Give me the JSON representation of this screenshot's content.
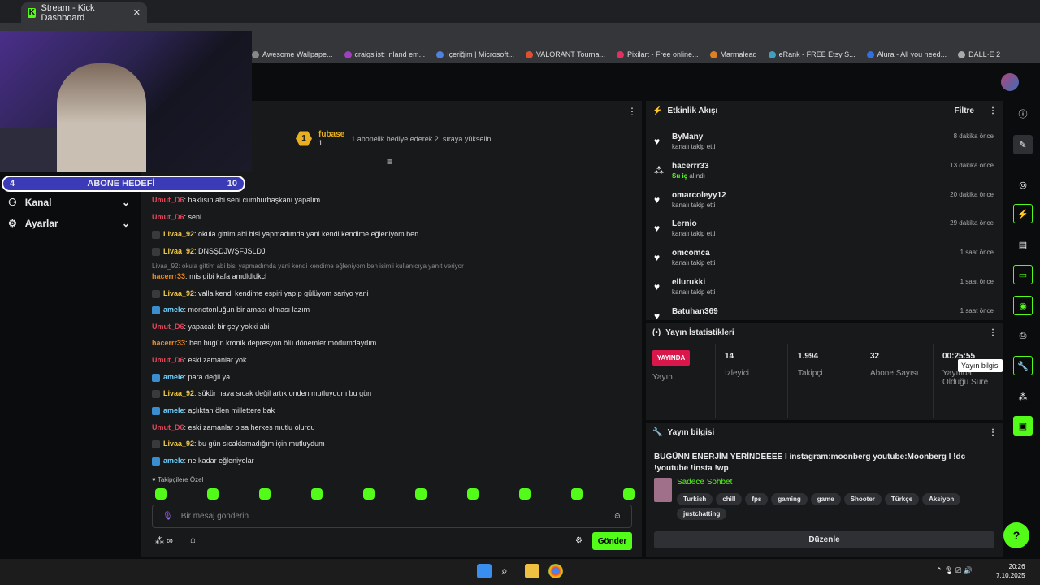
{
  "browser": {
    "tab_title": "Stream - Kick Dashboard",
    "bookmarks": [
      "Awesome Wallpape...",
      "craigslist: inland em...",
      "İçeriğim | Microsoft...",
      "VALORANT Tourna...",
      "Pixilart - Free online...",
      "Marmalead",
      "eRank - FREE Etsy S...",
      "Alura - All you need...",
      "DALL·E 2"
    ]
  },
  "overlay": {
    "sub_goal_current": "4",
    "sub_goal_label": "ABONE HEDEFİ",
    "sub_goal_target": "10"
  },
  "sidebar": {
    "items": [
      {
        "label": "Kanal",
        "icon": "people-icon"
      },
      {
        "label": "Ayarlar",
        "icon": "gear-icon"
      }
    ]
  },
  "chat": {
    "pinned": {
      "level": "1",
      "user": "fubase",
      "count": "1",
      "message": "1 abonelik hediye ederek 2. sıraya yükselin"
    },
    "messages": [
      {
        "user": "amele",
        "text": "",
        "color": "#6fd3ff"
      },
      {
        "user": "Umut_D6",
        "text": "haklısın abi seni cumhurbaşkanı yapalım",
        "color": "#e0465b"
      },
      {
        "user": "Umut_D6",
        "text": "seni",
        "color": "#e0465b"
      },
      {
        "user": "Livaa_92",
        "text": "okula gittim abi bisi yapmadımda yani kendi kendime eğleniyom ben",
        "color": "#f0c94a"
      },
      {
        "user": "Livaa_92",
        "text": "DNSŞDJWŞFJSLDJ",
        "color": "#f0c94a"
      },
      {
        "user": "hacerrr33",
        "text": "mis gibi kafa amdldldkcl",
        "color": "#f08a1c"
      },
      {
        "user": "Livaa_92",
        "text": "valla kendi kendime espiri yapıp gülüyom sariyo yani",
        "color": "#f0c94a"
      },
      {
        "user": "amele",
        "text": "monotonluğun bir amacı olması lazım",
        "color": "#6fd3ff"
      },
      {
        "user": "Umut_D6",
        "text": "yapacak bir şey yokki abi",
        "color": "#e0465b"
      },
      {
        "user": "hacerrr33",
        "text": "ben bugün kronik depresyon ölü dönemler modumdaydım",
        "color": "#f08a1c"
      },
      {
        "user": "Umut_D6",
        "text": "eski zamanlar yok",
        "color": "#e0465b"
      },
      {
        "user": "amele",
        "text": "para değil ya",
        "color": "#6fd3ff"
      },
      {
        "user": "Livaa_92",
        "text": "sükür hava sıcak değil artık onden mutluydum bu gün",
        "color": "#f0c94a"
      },
      {
        "user": "amele",
        "text": "açlıktan ölen millettere bak",
        "color": "#6fd3ff"
      },
      {
        "user": "Umut_D6",
        "text": "eski zamanlar olsa herkes mutlu olurdu",
        "color": "#e0465b"
      },
      {
        "user": "Livaa_92",
        "text": "bu gün sıcaklamadığım için mutluydum",
        "color": "#f0c94a"
      },
      {
        "user": "amele",
        "text": "ne kadar eğleniyolar",
        "color": "#6fd3ff"
      }
    ],
    "reply_note": "Livaa_92: okula gittim abi bisi yapmadımda yani kendi kendime eğleniyom ben isimli kullanıcıya yanıt veriyor",
    "followers_only": "Takipçilere Özel",
    "input_placeholder": "Bir mesaj gönderin",
    "send_label": "Gönder"
  },
  "activity": {
    "title": "Etkinlik Akışı",
    "filter": "Filtre",
    "items": [
      {
        "name": "ByMany",
        "sub": "kanalı takip etti",
        "time": "8 dakika önce"
      },
      {
        "name": "hacerrr33",
        "sub": "Su iç alındı",
        "time": "13 dakika önce"
      },
      {
        "name": "omarcoleyy12",
        "sub": "kanalı takip etti",
        "time": "20 dakika önce"
      },
      {
        "name": "Lernio",
        "sub": "kanalı takip etti",
        "time": "29 dakika önce"
      },
      {
        "name": "omcomca",
        "sub": "kanalı takip etti",
        "time": "1 saat önce"
      },
      {
        "name": "ellurukki",
        "sub": "kanalı takip etti",
        "time": "1 saat önce"
      },
      {
        "name": "Batuhan369",
        "sub": "",
        "time": "1 saat önce"
      }
    ]
  },
  "stats": {
    "title": "Yayın İstatistikleri",
    "live": "YAYINDA",
    "live_label": "Yayın",
    "viewers": "14",
    "viewers_label": "İzleyici",
    "followers": "1.994",
    "followers_label": "Takipçi",
    "subs": "32",
    "subs_label": "Abone Sayısı",
    "uptime": "00:25:55",
    "uptime_label": "Yayında Olduğu Süre"
  },
  "info": {
    "title": "Yayın bilgisi",
    "stream_title": "BUGÜNN ENERJİM YERİNDEEEE l instagram:moonberg youtube:Moonberg l !dc !youtube !insta !wp",
    "category": "Sadece Sohbet",
    "tags": [
      "Turkish",
      "chill",
      "fps",
      "gaming",
      "game",
      "Shooter",
      "Türkçe",
      "Aksiyon",
      "justchatting"
    ],
    "edit_label": "Düzenle"
  },
  "rail": {
    "tooltip": "Yayın bilgisi"
  },
  "taskbar": {
    "time": "20:26",
    "date": "7.10.2025"
  },
  "colors": {
    "accent": "#53fc18",
    "live": "#d9174a"
  }
}
